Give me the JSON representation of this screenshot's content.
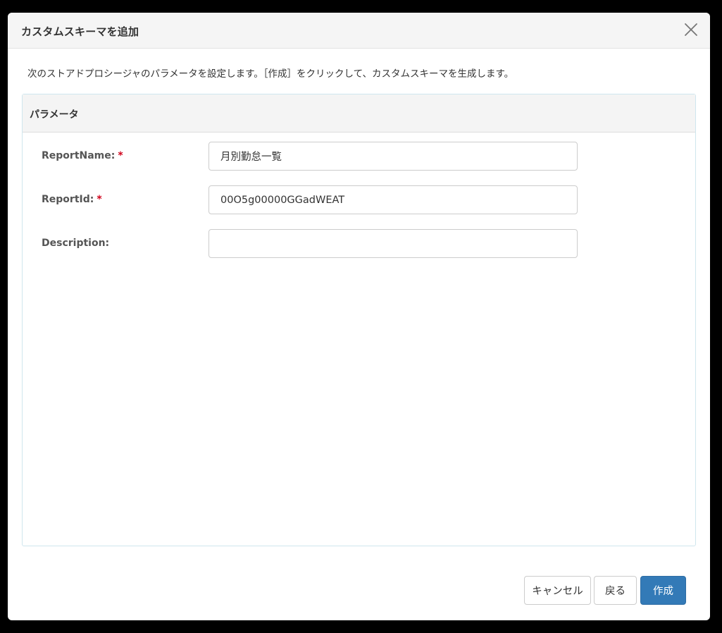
{
  "dialog": {
    "title": "カスタムスキーマを追加",
    "close_icon": "close-icon",
    "description": "次のストアドプロシージャのパラメータを設定します。［作成］をクリックして、カスタムスキーマを生成します。"
  },
  "panel": {
    "title": "パラメータ",
    "params": [
      {
        "label": "ReportName:",
        "required_mark": "*",
        "value": "月別勤怠一覧",
        "placeholder": ""
      },
      {
        "label": "ReportId:",
        "required_mark": "*",
        "value": "00O5g00000GGadWEAT",
        "placeholder": ""
      },
      {
        "label": "Description:",
        "required_mark": "",
        "value": "",
        "placeholder": ""
      }
    ]
  },
  "footer": {
    "cancel_label": "キャンセル",
    "back_label": "戻る",
    "create_label": "作成"
  },
  "colors": {
    "primary": "#337ab7",
    "required": "#d0021b"
  }
}
